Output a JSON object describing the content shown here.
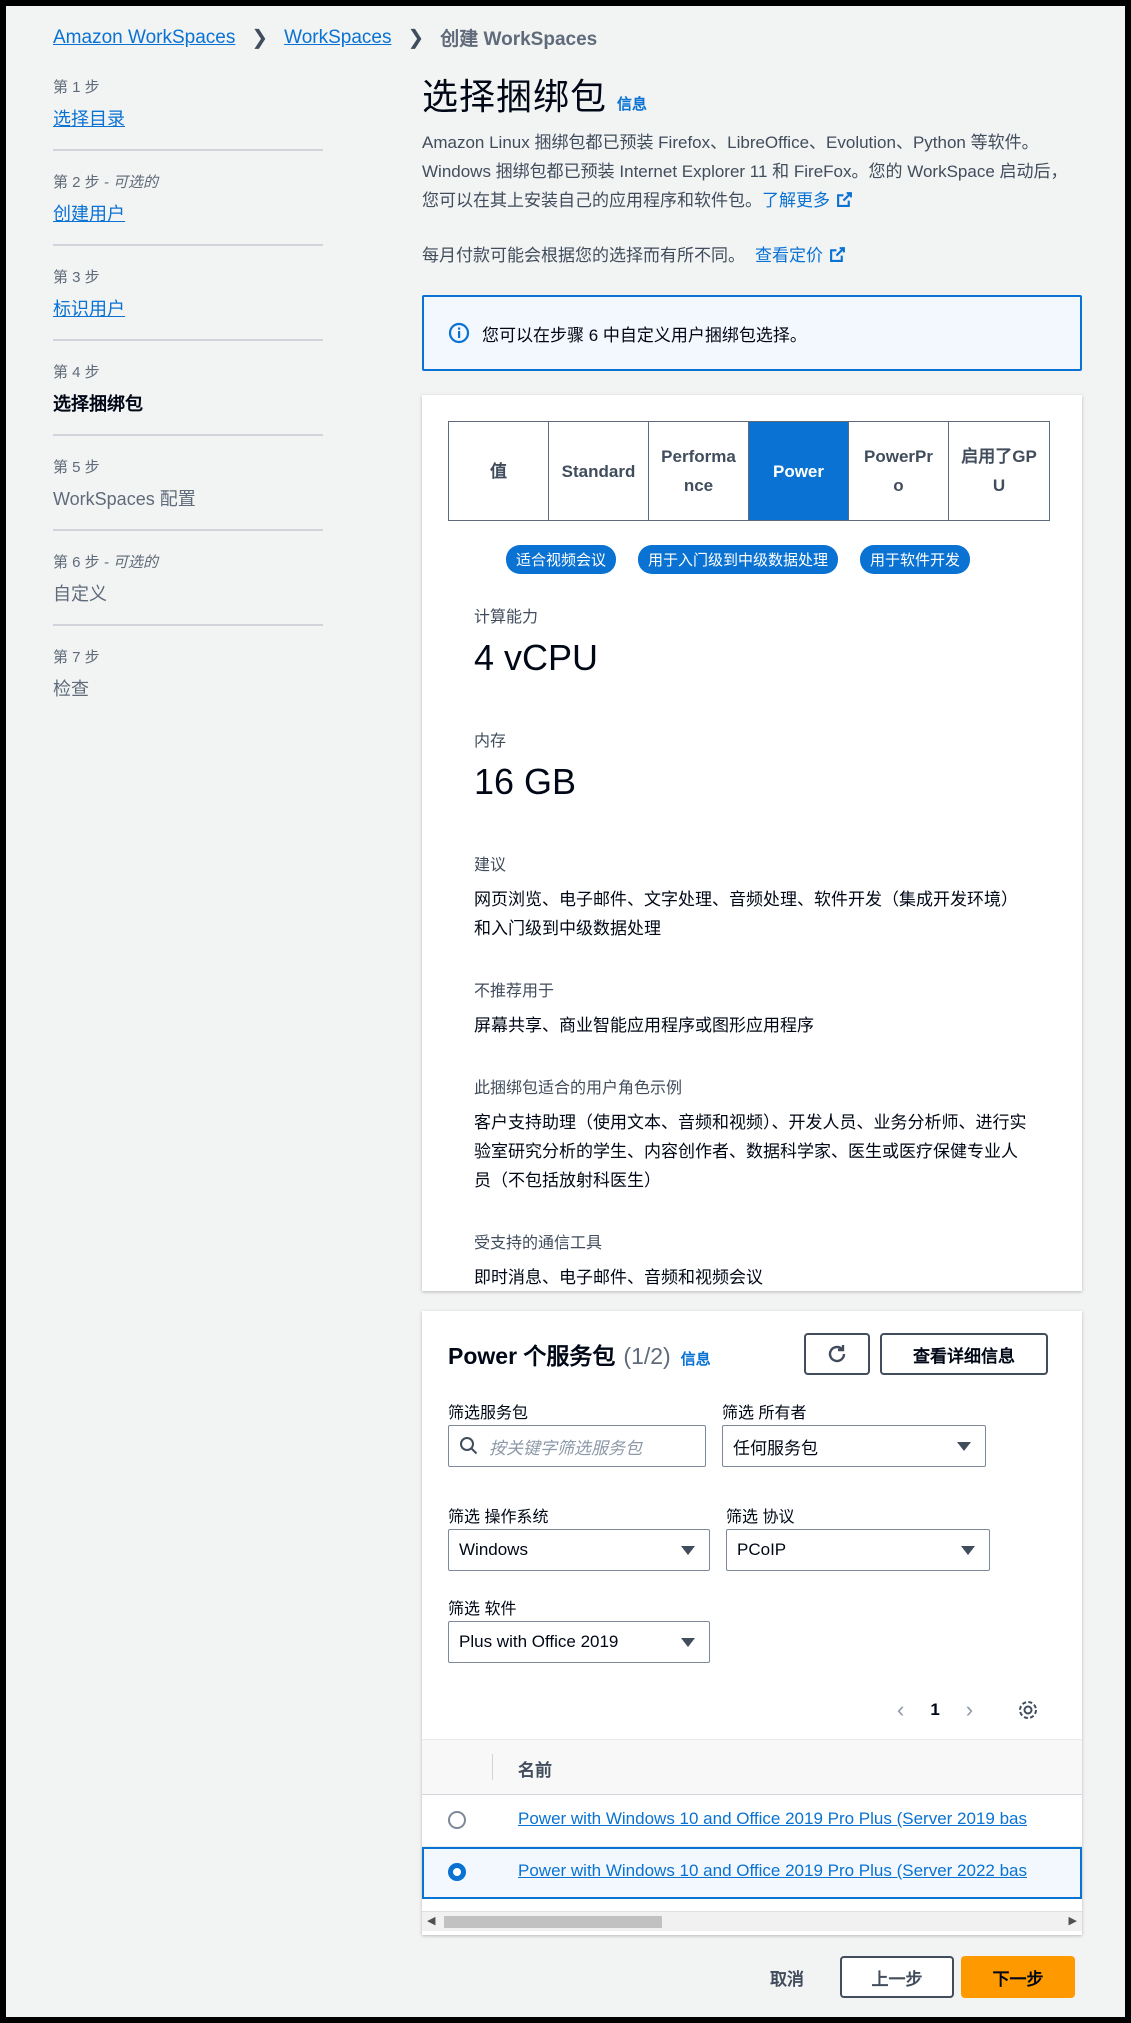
{
  "breadcrumb": {
    "items": [
      "Amazon WorkSpaces",
      "WorkSpaces"
    ],
    "current": "创建 WorkSpaces"
  },
  "steps": [
    {
      "num": "第 1 步",
      "optional": "",
      "title": "选择目录",
      "state": "link"
    },
    {
      "num": "第 2 步",
      "optional": " - 可选的",
      "title": "创建用户",
      "state": "link"
    },
    {
      "num": "第 3 步",
      "optional": "",
      "title": "标识用户",
      "state": "link"
    },
    {
      "num": "第 4 步",
      "optional": "",
      "title": "选择捆绑包",
      "state": "active"
    },
    {
      "num": "第 5 步",
      "optional": "",
      "title": "WorkSpaces 配置",
      "state": "disabled"
    },
    {
      "num": "第 6 步",
      "optional": " - 可选的",
      "title": "自定义",
      "state": "disabled"
    },
    {
      "num": "第 7 步",
      "optional": "",
      "title": "检查",
      "state": "disabled"
    }
  ],
  "header": {
    "title": "选择捆绑包",
    "info": "信息",
    "description": "Amazon Linux 捆绑包都已预装 Firefox、LibreOffice、Evolution、Python 等软件。Windows 捆绑包都已预装 Internet Explorer 11 和 FireFox。您的 WorkSpace 启动后，您可以在其上安装自己的应用程序和软件包。",
    "learn_more": "了解更多",
    "pricing_note": "每月付款可能会根据您的选择而有所不同。",
    "pricing_link": "查看定价"
  },
  "alert": {
    "text": "您可以在步骤 6 中自定义用户捆绑包选择。"
  },
  "bundle_types": {
    "options": [
      "值",
      "Standard",
      "Performance",
      "Power",
      "PowerPro",
      "启用了GPU"
    ],
    "selected": "Power"
  },
  "tags": [
    "适合视频会议",
    "用于入门级到中级数据处理",
    "用于软件开发"
  ],
  "specs": {
    "compute_label": "计算能力",
    "compute_value": "4 vCPU",
    "memory_label": "内存",
    "memory_value": "16 GB",
    "recommend_label": "建议",
    "recommend_value": "网页浏览、电子邮件、文字处理、音频处理、软件开发（集成开发环境）和入门级到中级数据处理",
    "not_recommend_label": "不推荐用于",
    "not_recommend_value": "屏幕共享、商业智能应用程序或图形应用程序",
    "persona_label": "此捆绑包适合的用户角色示例",
    "persona_value": "客户支持助理（使用文本、音频和视频）、开发人员、业务分析师、进行实验室研究分析的学生、内容创作者、数据科学家、医生或医疗保健专业人员（不包括放射科医生）",
    "comm_label": "受支持的通信工具",
    "comm_value": "即时消息、电子邮件、音频和视频会议"
  },
  "table": {
    "title": "Power 个服务包",
    "count": "(1/2)",
    "info": "信息",
    "details_button": "查看详细信息",
    "filter_label": "筛选服务包",
    "filter_placeholder": "按关键字筛选服务包",
    "owner_label": "筛选 所有者",
    "owner_value": "任何服务包",
    "os_label": "筛选 操作系统",
    "os_value": "Windows",
    "protocol_label": "筛选 协议",
    "protocol_value": "PCoIP",
    "software_label": "筛选 软件",
    "software_value": "Plus with Office 2019",
    "page": "1",
    "column_name": "名前",
    "rows": [
      {
        "name": "Power with Windows 10 and Office 2019 Pro Plus (Server 2019 bas",
        "selected": false
      },
      {
        "name": "Power with Windows 10 and Office 2019 Pro Plus (Server 2022 bas",
        "selected": true
      }
    ]
  },
  "footer": {
    "cancel": "取消",
    "previous": "上一步",
    "next": "下一步"
  },
  "colors": {
    "accent": "#0972d3",
    "primary_button": "#ff9900",
    "background": "#f2f3f3"
  }
}
